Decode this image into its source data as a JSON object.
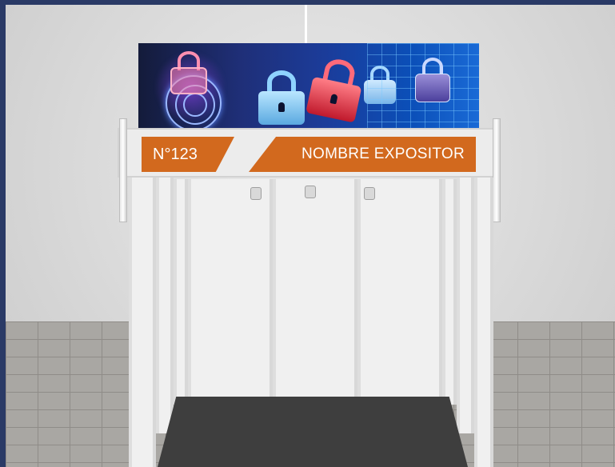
{
  "booth": {
    "number_label": "N°123",
    "exhibitor_label": "NOMBRE EXPOSITOR"
  },
  "banner": {
    "icons": [
      "fingerprint-lock-icon",
      "padlocks-icon",
      "circuit-lock-icon"
    ]
  },
  "colors": {
    "frame": "#2a3a66",
    "wall": "#dcdcdc",
    "sign_orange": "#d2691e",
    "carpet": "#3e3e3e",
    "floor_tile": "#a9a7a3"
  }
}
